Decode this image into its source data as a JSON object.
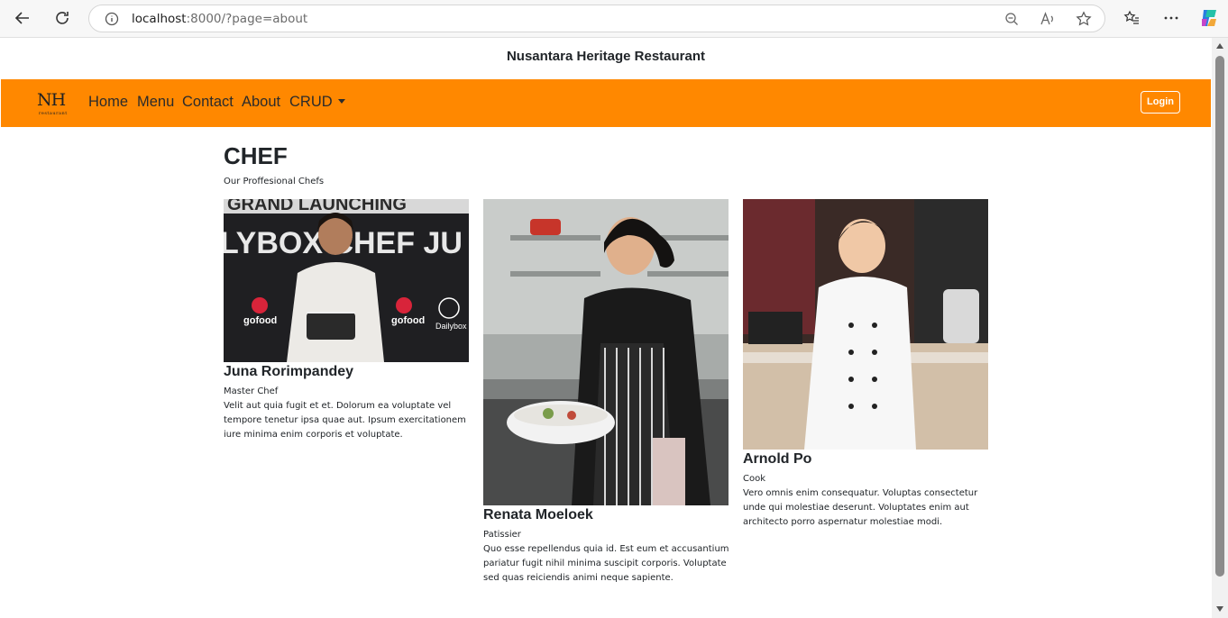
{
  "browser": {
    "url_host": "localhost",
    "url_rest": ":8000/?page=about",
    "icons": [
      "back-arrow-icon",
      "refresh-icon",
      "info-icon",
      "zoom-out-icon",
      "read-aloud-icon",
      "favorite-star-icon",
      "favorites-list-icon",
      "more-icon",
      "copilot-icon"
    ]
  },
  "site": {
    "title": "Nusantara Heritage Restaurant",
    "logo_mark": "NH",
    "logo_sub": "restaurant"
  },
  "navbar": {
    "links": [
      "Home",
      "Menu",
      "Contact",
      "About",
      "CRUD"
    ],
    "login_label": "Login",
    "color": "#ff8800"
  },
  "section": {
    "title": "CHEF",
    "subtitle": "Our Proffesional Chefs"
  },
  "chefs": [
    {
      "name": "Juna Rorimpandey",
      "role": "Master Chef",
      "desc": "Velit aut quia fugit et et. Dolorum ea voluptate vel tempore tenetur ipsa quae aut. Ipsum exercitationem iure minima enim corporis et voluptate.",
      "backdrop": [
        "GRAND LAUNCHING",
        "LYBOX CHEF JU",
        "gofood",
        "gofood",
        "Dailybox"
      ]
    },
    {
      "name": "Renata Moeloek",
      "role": "Patissier",
      "desc": "Quo esse repellendus quia id. Est eum et accusantium pariatur fugit nihil minima suscipit corporis. Voluptate sed quas reiciendis animi neque sapiente."
    },
    {
      "name": "Arnold Po",
      "role": "Cook",
      "desc": "Vero omnis enim consequatur. Voluptas consectetur unde qui molestiae deserunt. Voluptates enim aut architecto porro aspernatur molestiae modi."
    }
  ]
}
